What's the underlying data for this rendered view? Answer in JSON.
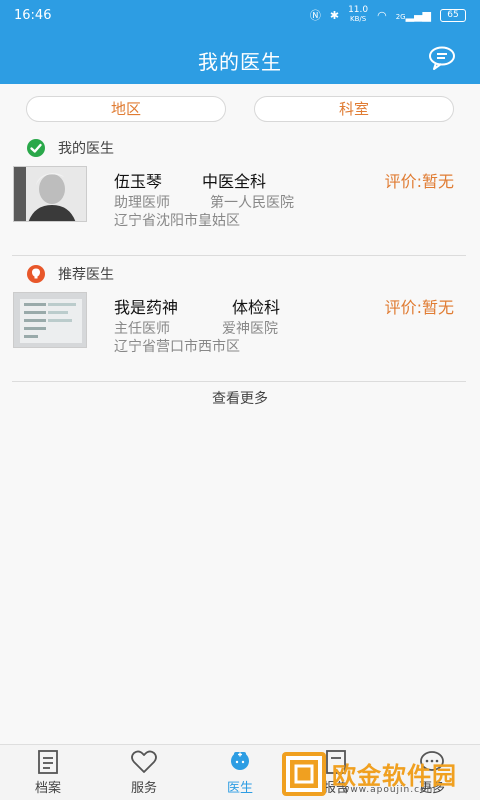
{
  "status": {
    "time": "16:46",
    "net_speed": "11.0",
    "net_unit": "KB/S",
    "signal": "2G",
    "battery": "65"
  },
  "header": {
    "title": "我的医生",
    "msg_icon": "chat-bubble-icon"
  },
  "filters": {
    "region": "地区",
    "department": "科室"
  },
  "my_doctors": {
    "heading": "我的医生",
    "items": [
      {
        "name": "伍玉琴",
        "department": "中医全科",
        "rating": "评价:暂无",
        "title": "助理医师",
        "hospital": "第一人民医院",
        "address": "辽宁省沈阳市皇姑区"
      }
    ]
  },
  "recommended": {
    "heading": "推荐医生",
    "items": [
      {
        "name": "我是药神",
        "department": "体检科",
        "rating": "评价:暂无",
        "title": "主任医师",
        "hospital": "爱神医院",
        "address": "辽宁省营口市西市区"
      }
    ]
  },
  "more_link": "查看更多",
  "tabs": [
    {
      "label": "档案",
      "icon": "clipboard-icon"
    },
    {
      "label": "服务",
      "icon": "heart-icon"
    },
    {
      "label": "医生",
      "icon": "doctor-icon"
    },
    {
      "label": "报告",
      "icon": "report-icon"
    },
    {
      "label": "更多",
      "icon": "more-icon"
    }
  ],
  "watermark": {
    "text": "欧金软件园",
    "url": "www.apoujin.com"
  },
  "colors": {
    "primary": "#2d9de3",
    "accent": "#e07c33"
  }
}
